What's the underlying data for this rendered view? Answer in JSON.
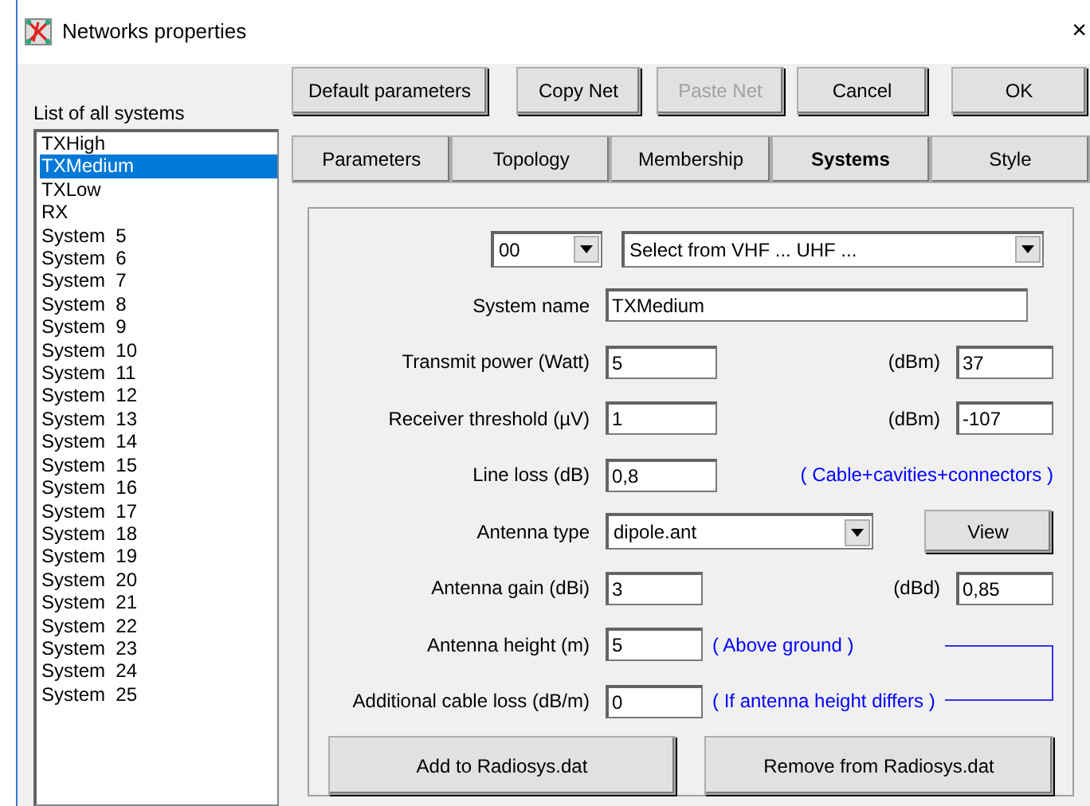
{
  "window": {
    "title": "Networks properties",
    "close": "×"
  },
  "toolbar": [
    {
      "label": "Default parameters",
      "disabled": false
    },
    {
      "label": "Copy Net",
      "disabled": false
    },
    {
      "label": "Paste Net",
      "disabled": true
    },
    {
      "label": "Cancel",
      "disabled": false
    },
    {
      "label": "OK",
      "disabled": false
    }
  ],
  "systems_list": {
    "label": "List of all systems",
    "items": [
      {
        "label": "TXHigh",
        "selected": false
      },
      {
        "label": "TXMedium",
        "selected": true
      },
      {
        "label": "TXLow",
        "selected": false
      },
      {
        "label": "RX",
        "selected": false
      },
      {
        "label": "System  5",
        "selected": false
      },
      {
        "label": "System  6",
        "selected": false
      },
      {
        "label": "System  7",
        "selected": false
      },
      {
        "label": "System  8",
        "selected": false
      },
      {
        "label": "System  9",
        "selected": false
      },
      {
        "label": "System  10",
        "selected": false
      },
      {
        "label": "System  11",
        "selected": false
      },
      {
        "label": "System  12",
        "selected": false
      },
      {
        "label": "System  13",
        "selected": false
      },
      {
        "label": "System  14",
        "selected": false
      },
      {
        "label": "System  15",
        "selected": false
      },
      {
        "label": "System  16",
        "selected": false
      },
      {
        "label": "System  17",
        "selected": false
      },
      {
        "label": "System  18",
        "selected": false
      },
      {
        "label": "System  19",
        "selected": false
      },
      {
        "label": "System  20",
        "selected": false
      },
      {
        "label": "System  21",
        "selected": false
      },
      {
        "label": "System  22",
        "selected": false
      },
      {
        "label": "System  23",
        "selected": false
      },
      {
        "label": "System  24",
        "selected": false
      },
      {
        "label": "System  25",
        "selected": false
      }
    ]
  },
  "tabs": [
    {
      "label": "Parameters",
      "selected": false
    },
    {
      "label": "Topology",
      "selected": false
    },
    {
      "label": "Membership",
      "selected": false
    },
    {
      "label": "Systems",
      "selected": true
    },
    {
      "label": "Style",
      "selected": false
    }
  ],
  "selectors": [
    {
      "value": "00"
    },
    {
      "value": "Select from VHF ... UHF ..."
    }
  ],
  "fields": [
    {
      "kind": "wide",
      "label": "System name",
      "value": "TXMedium"
    },
    {
      "kind": "text",
      "label": "Transmit power (Watt)",
      "value": "5",
      "unit_label": "(dBm)",
      "unit_value": "37"
    },
    {
      "kind": "text",
      "label": "Receiver threshold (µV)",
      "value": "1",
      "unit_label": "(dBm)",
      "unit_value": "-107"
    },
    {
      "kind": "text",
      "label": "Line loss (dB)",
      "value": "0,8",
      "note": "( Cable+cavities+connectors )"
    },
    {
      "kind": "combo",
      "label": "Antenna type",
      "value": "dipole.ant",
      "button": "View"
    },
    {
      "kind": "short",
      "label": "Antenna gain (dBi)",
      "value": "3",
      "unit_label": "(dBd)",
      "unit_value": "0,85"
    },
    {
      "kind": "short",
      "label": "Antenna height (m)",
      "value": "5",
      "note": "( Above ground )",
      "bracketed": true
    },
    {
      "kind": "short",
      "label": "Additional cable loss (dB/m)",
      "value": "0",
      "note": "( If antenna height differs )",
      "bracketed": true
    }
  ],
  "actions": [
    {
      "label": "Add to Radiosys.dat"
    },
    {
      "label": "Remove from Radiosys.dat"
    }
  ]
}
